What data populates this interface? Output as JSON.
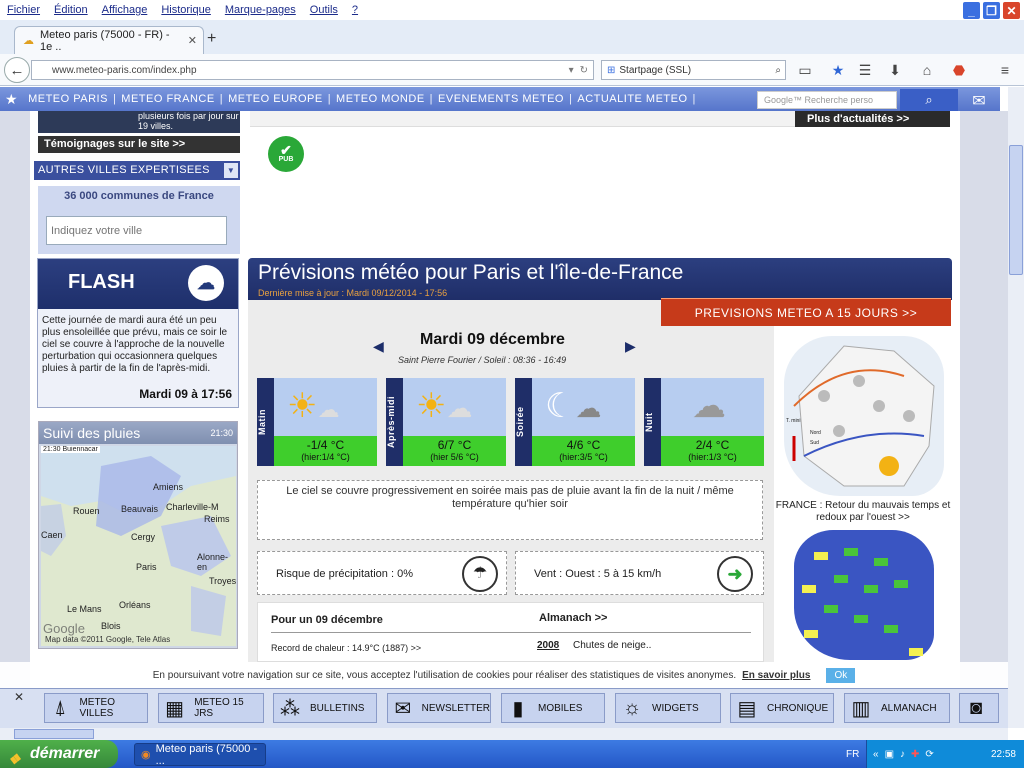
{
  "menu": {
    "items": [
      "Fichier",
      "Édition",
      "Affichage",
      "Historique",
      "Marque-pages",
      "Outils",
      "?"
    ]
  },
  "window": {
    "minimize": "_",
    "restore": "❐",
    "close": "✕"
  },
  "tab": {
    "title": "Meteo paris (75000 - FR) - 1e ..",
    "close": "✕",
    "new": "+"
  },
  "nav": {
    "url": "www.meteo-paris.com/index.php",
    "search_engine": "Startpage (SSL)",
    "back": "←"
  },
  "sitenav": {
    "items": [
      "METEO PARIS",
      "METEO FRANCE",
      "METEO EUROPE",
      "METEO MONDE",
      "EVENEMENTS METEO",
      "ACTUALITE METEO"
    ],
    "search_placeholder": "Google™ Recherche perso"
  },
  "left": {
    "top_text": "plusieurs fois par jour sur 19 villes.",
    "temoignages": "Témoignages sur le site >>",
    "autres": "AUTRES VILLES EXPERTISEES",
    "communes": "36 000 communes de France",
    "ville_placeholder": "Indiquez votre ville",
    "flash_title": "FLASH",
    "flash_text": "Cette journée de mardi aura été un peu plus ensoleillée que prévu, mais ce soir le ciel se couvre à l'approche de la nouvelle perturbation qui occasionnera quelques pluies à partir de la fin de l'après-midi.",
    "flash_date": "Mardi 09 à 17:56",
    "pluies_title": "Suivi des pluies",
    "pluies_time": "21:30",
    "map_timestamp": "21:30 Buiennacar",
    "map_labels": [
      "Amiens",
      "Charleville-M",
      "Reims",
      "Beauvais",
      "Rouen",
      "Paris",
      "Cergy",
      "Troyes",
      "Le Mans",
      "Orléans",
      "Blois",
      "Alonne-en",
      "Caen"
    ],
    "map_copy": "Map data ©2011 Google, Tele Atlas",
    "map_google": "Google"
  },
  "main": {
    "plus_actu": "Plus d'actualités >>",
    "pub": "PUB",
    "title": "Prévisions météo pour Paris et l'île-de-France",
    "updated": "Dernière mise à jour : Mardi 09/12/2014 - 17:56",
    "prev15": "PREVISIONS METEO A 15 JOURS >>",
    "day": "Mardi 09 décembre",
    "saint": "Saint Pierre Fourier / Soleil : 08:36 - 16:49",
    "cards": [
      {
        "period": "Matin",
        "temp": "-1/4 °C",
        "hier": "(hier:1/4 °C)",
        "icon": "sun-cloud-icon"
      },
      {
        "period": "Après-midi",
        "temp": "6/7 °C",
        "hier": "(hier 5/6 °C)",
        "icon": "sun-cloud-icon"
      },
      {
        "period": "Soirée",
        "temp": "4/6 °C",
        "hier": "(hier:3/5 °C)",
        "icon": "moon-cloud-icon"
      },
      {
        "period": "Nuit",
        "temp": "2/4 °C",
        "hier": "(hier:1/3 °C)",
        "icon": "cloud-icon"
      }
    ],
    "description": "Le ciel se couvre progressivement en soirée mais pas de pluie avant la fin de la nuit / même température qu'hier soir",
    "risque": "Risque de précipitation : 0%",
    "vent": "Vent : Ouest : 5 à 15 km/h",
    "almanach_day": "Pour un 09 décembre",
    "almanach_link": "Almanach >>",
    "record": "Record de chaleur : 14.9°C (1887) >>",
    "year": "2008",
    "event": "Chutes de neige..",
    "france_label": "FRANCE : Retour du mauvais temps et redoux par l'ouest >>",
    "map_legend": [
      "T. mini",
      "Nord",
      "Sud"
    ]
  },
  "cookie": {
    "text": "En poursuivant votre navigation sur ce site, vous acceptez l'utilisation de cookies pour réaliser des statistiques de visites anonymes.",
    "link": "En savoir plus",
    "ok": "Ok"
  },
  "bottom": {
    "items": [
      "METEO VILLES",
      "METEO 15 JRS",
      "BULLETINS",
      "NEWSLETTER",
      "MOBILES",
      "WIDGETS",
      "CHRONIQUE",
      "ALMANACH"
    ]
  },
  "taskbar": {
    "start": "démarrer",
    "task": "Meteo paris (75000 - ...",
    "lang": "FR",
    "clock": "22:58"
  },
  "colors": {
    "navy": "#1f2e68",
    "accent_red": "#c63a1a",
    "green": "#3fce2c",
    "sitenav": "#5675cb"
  }
}
